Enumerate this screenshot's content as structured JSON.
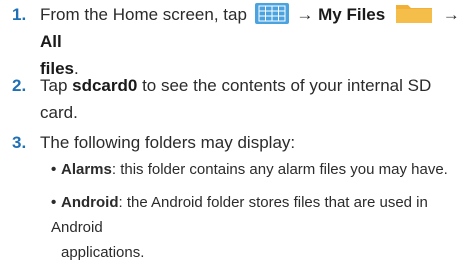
{
  "steps": [
    {
      "number": "1.",
      "lead": "From the Home screen, tap",
      "arrow1": "→",
      "my_files": "My Files",
      "arrow2": "→",
      "all_files_a": "All",
      "all_files_b": "files",
      "end": "."
    },
    {
      "number": "2.",
      "lead": "Tap ",
      "sdcard": "sdcard0",
      "rest_line1": " to see the contents of your internal SD",
      "rest_line2": "card."
    },
    {
      "number": "3.",
      "text": "The following folders may display:"
    }
  ],
  "bullets": [
    {
      "term": "Alarms",
      "desc": ": this folder contains any alarm files you may have."
    },
    {
      "term": "Android",
      "desc_line1": ": the Android folder stores files that are used in Android",
      "desc_line2": "applications."
    }
  ],
  "icons": {
    "apps": "apps-grid-icon",
    "folder": "folder-icon"
  },
  "colors": {
    "number": "#1f6fb5",
    "apps_icon_bg": "#4aa3df",
    "folder": "#f2b136"
  }
}
